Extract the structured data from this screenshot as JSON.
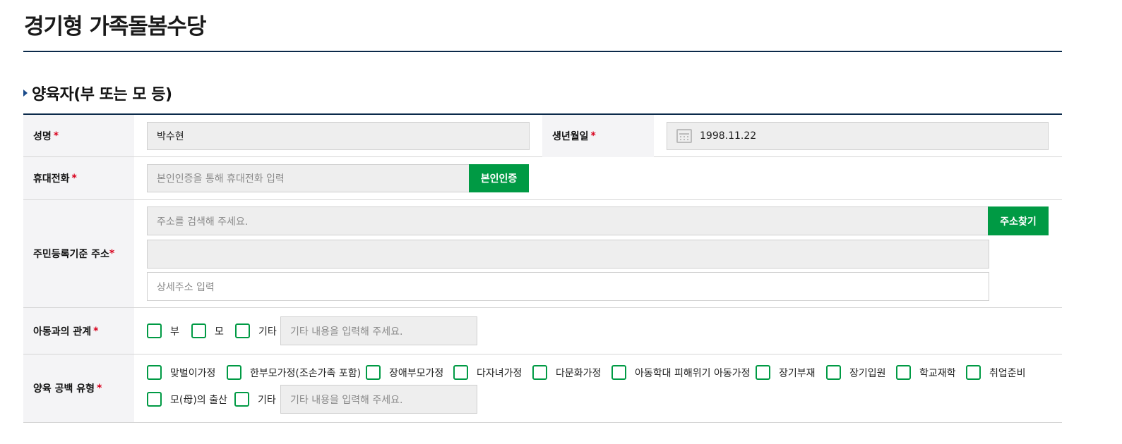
{
  "page": {
    "title": "경기형 가족돌봄수당"
  },
  "section": {
    "title": "양육자(부 또는 모 등)"
  },
  "required_mark": "*",
  "fields": {
    "name": {
      "label": "성명",
      "value": "박수현"
    },
    "birth": {
      "label": "생년월일",
      "value": "1998.11.22",
      "icon": "calendar-icon"
    },
    "phone": {
      "label": "휴대전화",
      "placeholder": "본인인증을 통해 휴대전화 입력",
      "button": "본인인증"
    },
    "address": {
      "label": "주민등록기준 주소",
      "search_placeholder": "주소를 검색해 주세요.",
      "search_button": "주소찾기",
      "line2_value": "",
      "detail_placeholder": "상세주소 입력"
    },
    "relation": {
      "label": "아동과의 관계",
      "options": [
        "부",
        "모",
        "기타"
      ],
      "other_placeholder": "기타 내용을 입력해 주세요."
    },
    "gap_type": {
      "label": "양육 공백 유형",
      "options_row1": [
        "맞벌이가정",
        "한부모가정(조손가족 포함)",
        "장애부모가정",
        "다자녀가정",
        "다문화가정",
        "아동학대 피해위기 아동가정",
        "장기부재",
        "장기입원",
        "학교재학",
        "취업준비"
      ],
      "options_row2": [
        "모(母)의 출산",
        "기타"
      ],
      "other_placeholder": "기타 내용을 입력해 주세요."
    }
  },
  "colors": {
    "accent_green": "#009a44",
    "navy_rule": "#0b2a4a",
    "required_red": "#d8001c"
  }
}
